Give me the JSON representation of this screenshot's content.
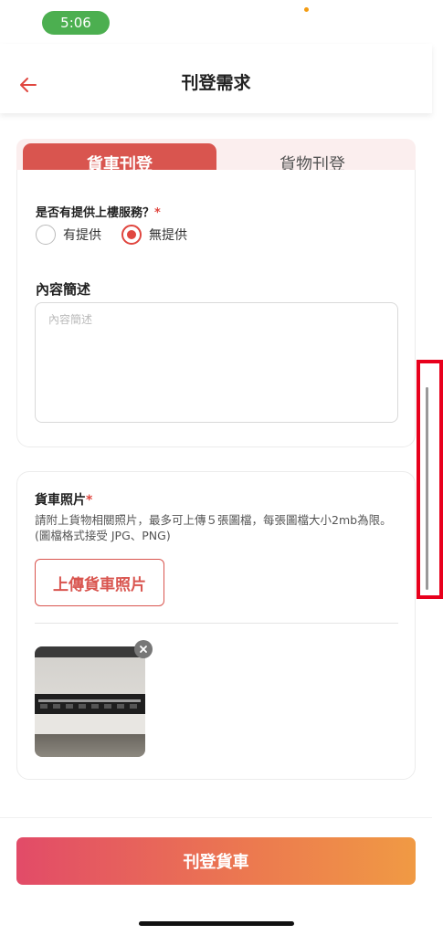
{
  "status_bar": {
    "time": "5:06"
  },
  "header": {
    "title": "刊登需求",
    "back_icon": "arrow-left-icon"
  },
  "tabs": [
    {
      "label": "貨車刊登",
      "active": true
    },
    {
      "label": "貨物刊登",
      "active": false
    }
  ],
  "service_question": {
    "label": "是否有提供上樓服務？",
    "required_mark": "*",
    "options": [
      {
        "label": "有提供",
        "selected": false
      },
      {
        "label": "無提供",
        "selected": true
      }
    ]
  },
  "description": {
    "label": "內容簡述",
    "placeholder": "內容簡述",
    "value": ""
  },
  "truck_photos": {
    "label": "貨車照片",
    "required_mark": "*",
    "hint": "請附上貨物相關照片，最多可上傳５張圖檔，每張圖檔大小2mb為限。(圖檔格式接受 JPG、PNG)",
    "upload_button": "上傳貨車照片",
    "remove_icon": "close-icon"
  },
  "submit_button": "刊登貨車",
  "colors": {
    "primary": "#d9554f",
    "radio_accent": "#e0463f",
    "gradient_start": "#e24b68",
    "gradient_end": "#f09a44",
    "time_pill": "#4caf50"
  }
}
